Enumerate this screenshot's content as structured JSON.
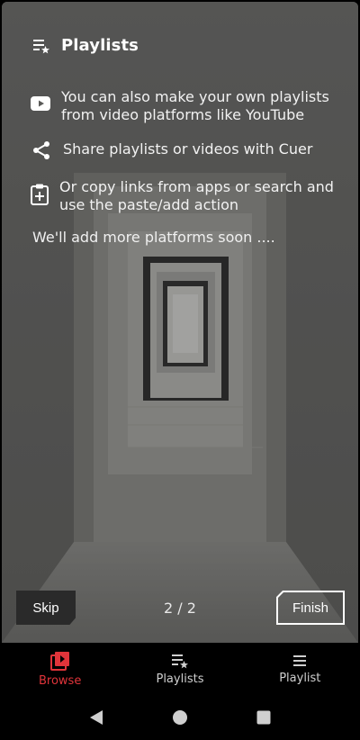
{
  "header": {
    "title": "Playlists",
    "icon": "playlist-star-icon"
  },
  "features": [
    {
      "icon": "youtube-icon",
      "text": "You can also make your own playlists from video platforms like YouTube"
    },
    {
      "icon": "share-icon",
      "text": "Share playlists or videos with Cuer"
    },
    {
      "icon": "clipboard-add-icon",
      "text": "Or copy links from apps or search and use the paste/add action"
    }
  ],
  "note": "We'll add more platforms soon ....",
  "controls": {
    "skip_label": "Skip",
    "page_indicator": "2 / 2",
    "finish_label": "Finish"
  },
  "bottom_nav": [
    {
      "label": "Browse",
      "icon": "browse-icon",
      "active": true
    },
    {
      "label": "Playlists",
      "icon": "playlist-star-icon",
      "active": false
    },
    {
      "label": "Playlist",
      "icon": "list-icon",
      "active": false
    }
  ],
  "system_nav": [
    "back-icon",
    "home-icon",
    "recents-icon"
  ],
  "colors": {
    "accent": "#e0343a",
    "overlay": "#5a5a58",
    "nav_bg": "#000000"
  }
}
